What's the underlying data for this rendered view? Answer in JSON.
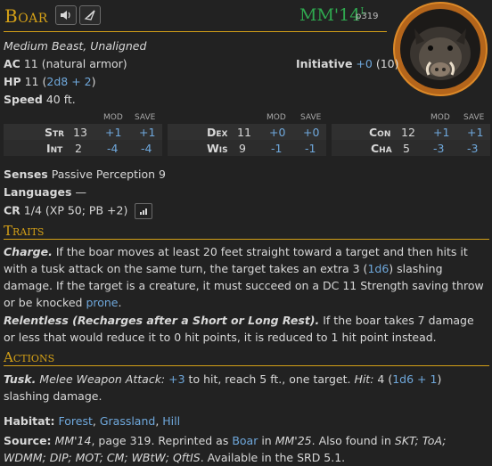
{
  "header": {
    "name": "Boar",
    "source_code": "MM'14",
    "source_superscript": "L",
    "source_page": "p319"
  },
  "meta": {
    "size_type": "Medium Beast, Unaligned",
    "ac_label": "AC",
    "ac_value": "11 (natural armor)",
    "initiative_label": "Initiative",
    "initiative_mod": "+0",
    "initiative_score": "(10)",
    "hp_label": "HP",
    "hp_value": "11",
    "hp_dice": "2d8 + 2",
    "speed_label": "Speed",
    "speed_value": "40 ft."
  },
  "stats": {
    "mod_header": "MOD",
    "save_header": "SAVE",
    "str": {
      "label": "Str",
      "score": "13",
      "mod": "+1",
      "save": "+1"
    },
    "int": {
      "label": "Int",
      "score": "2",
      "mod": "-4",
      "save": "-4"
    },
    "dex": {
      "label": "Dex",
      "score": "11",
      "mod": "+0",
      "save": "+0"
    },
    "wis": {
      "label": "Wis",
      "score": "9",
      "mod": "-1",
      "save": "-1"
    },
    "con": {
      "label": "Con",
      "score": "12",
      "mod": "+1",
      "save": "+1"
    },
    "cha": {
      "label": "Cha",
      "score": "5",
      "mod": "-3",
      "save": "-3"
    }
  },
  "details": {
    "senses_label": "Senses",
    "senses_value": "Passive Perception 9",
    "languages_label": "Languages",
    "languages_value": "—",
    "cr_label": "CR",
    "cr_value": "1/4 (XP 50; PB +2)"
  },
  "traits": {
    "title": "Traits",
    "charge_name": "Charge.",
    "charge_text_1": "If the boar moves at least 20 feet straight toward a target and then hits it with a tusk attack on the same turn, the target takes an extra 3 (",
    "charge_dice": "1d6",
    "charge_text_2": ") slashing damage. If the target is a creature, it must succeed on a DC 11 Strength saving throw or be knocked ",
    "charge_condition": "prone",
    "charge_text_3": ".",
    "relentless_name": "Relentless (Recharges after a Short or Long Rest).",
    "relentless_text": "If the boar takes 7 damage or less that would reduce it to 0 hit points, it is reduced to 1 hit point instead."
  },
  "actions": {
    "title": "Actions",
    "tusk_name": "Tusk.",
    "tusk_attack_type": "Melee Weapon Attack:",
    "tusk_to_hit": "+3",
    "tusk_text_1": "to hit, reach 5 ft., one target.",
    "tusk_hit_label": "Hit:",
    "tusk_damage": "4 (",
    "tusk_dice": "1d6 + 1",
    "tusk_text_2": ") slashing damage."
  },
  "footer": {
    "habitat_label": "Habitat:",
    "habitat_1": "Forest",
    "habitat_2": "Grassland",
    "habitat_3": "Hill",
    "source_label": "Source:",
    "source_book": "MM'14",
    "source_text_1": ", page 319. Reprinted as ",
    "source_reprint": "Boar",
    "source_text_2": " in ",
    "source_reprint_book": "MM'25",
    "source_text_3": ". Also found in ",
    "source_also_1": "SKT; ToA; WDMM;",
    "source_also_2": "DIP; MOT; CM; WBtW; QftIS",
    "source_text_4": ". Available in the SRD 5.1."
  }
}
